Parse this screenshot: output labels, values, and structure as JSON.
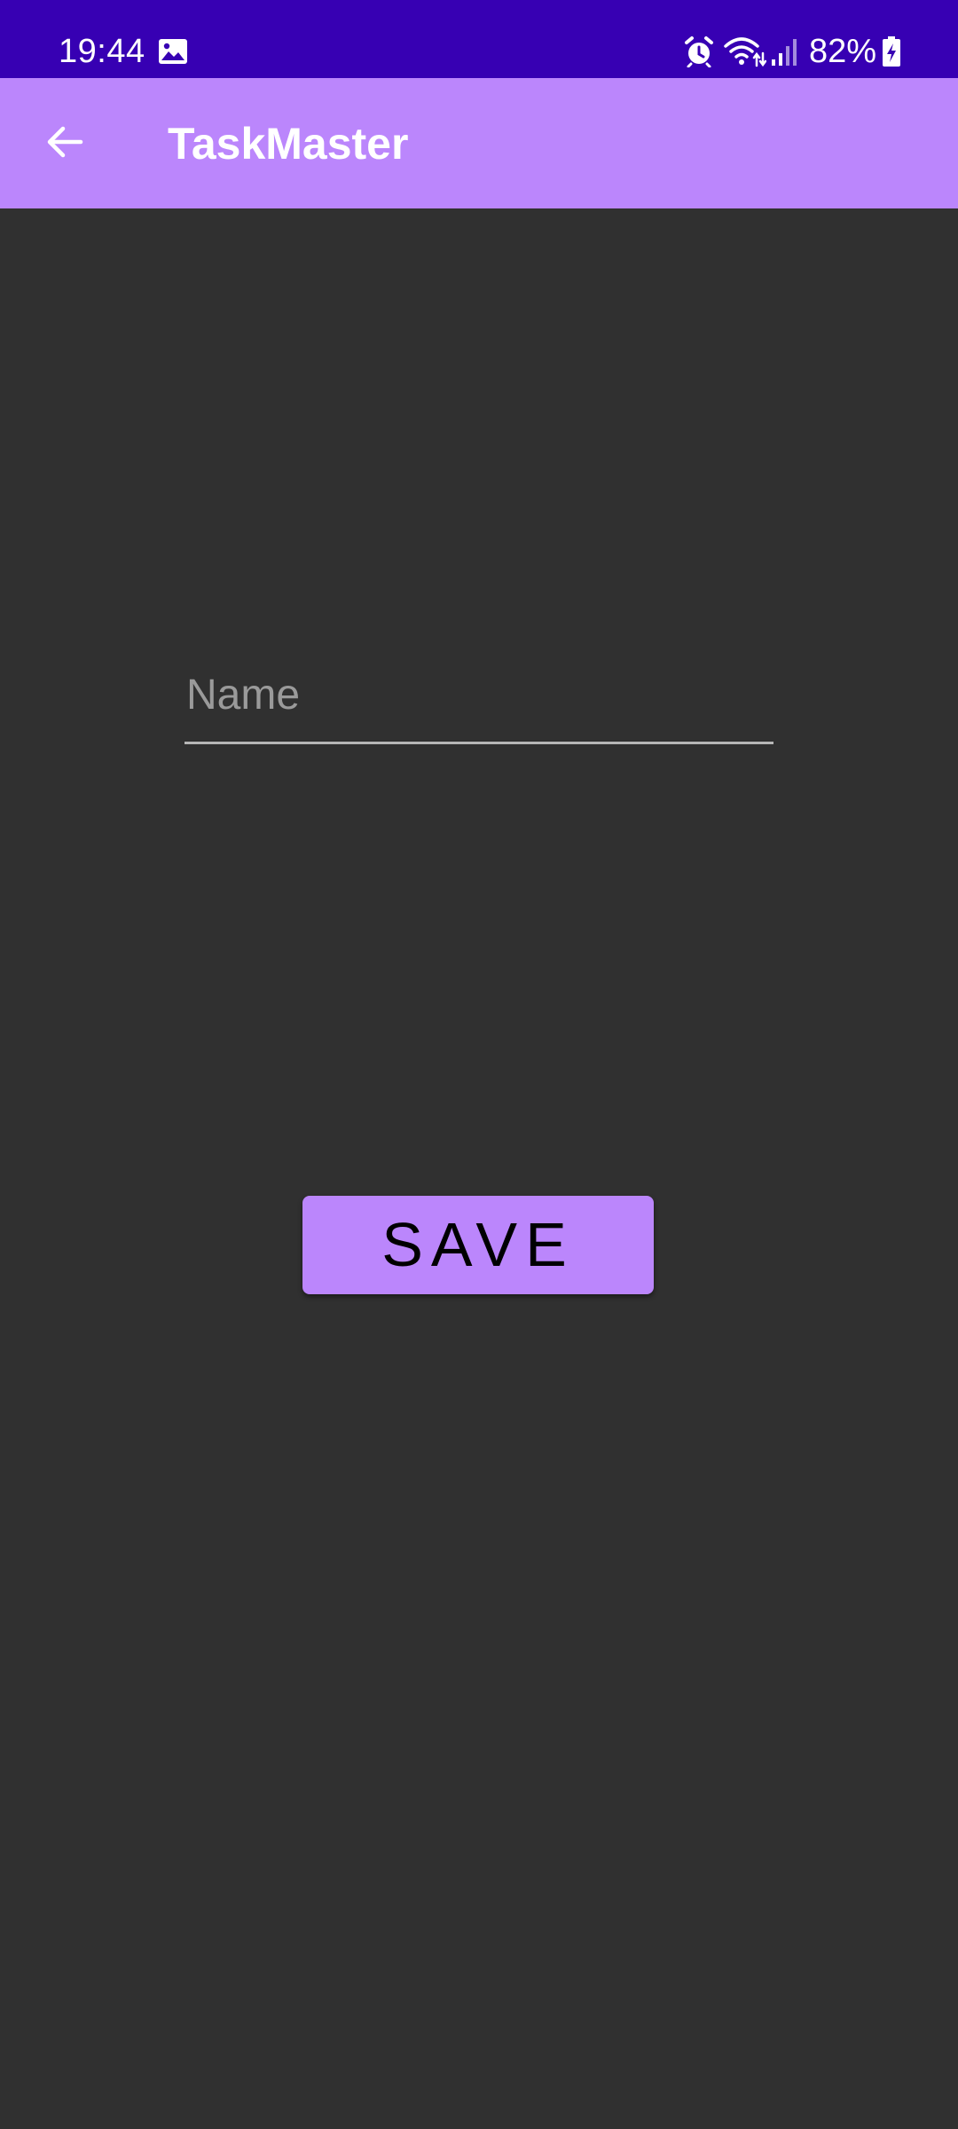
{
  "status_bar": {
    "time": "19:44",
    "battery": "82%",
    "icons": [
      "gallery-icon",
      "alarm-icon",
      "wifi-icon",
      "signal-icon",
      "battery-charging-icon"
    ],
    "background_color": "#3700b3"
  },
  "app_bar": {
    "title": "TaskMaster",
    "back_icon": "arrow-back-icon",
    "background_color": "#bb86fc"
  },
  "form": {
    "name_placeholder": "Name",
    "name_value": "",
    "save_label": "SAVE",
    "button_color": "#bb86fc"
  },
  "theme": {
    "background_color": "#303030"
  }
}
